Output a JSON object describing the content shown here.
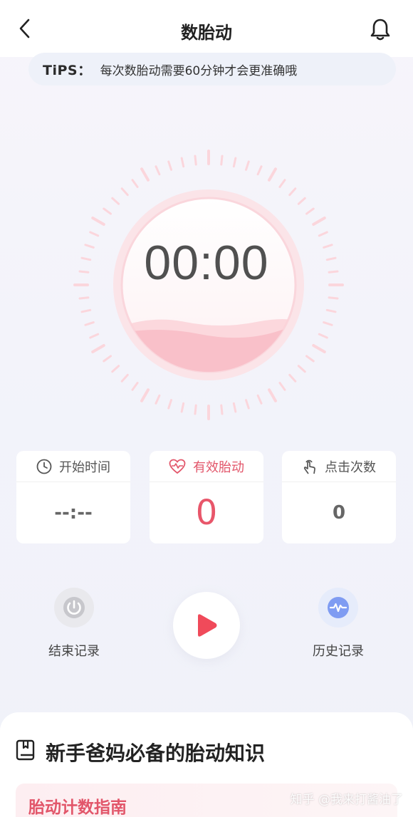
{
  "header": {
    "title": "数胎动"
  },
  "tips": {
    "label": "TiPS：",
    "text": "每次数胎动需要60分钟才会更准确哦"
  },
  "timer": {
    "display": "00:00"
  },
  "stats": [
    {
      "label": "开始时间",
      "value": "--:--"
    },
    {
      "label": "有效胎动",
      "value": "0"
    },
    {
      "label": "点击次数",
      "value": "0"
    }
  ],
  "controls": {
    "end_label": "结束记录",
    "history_label": "历史记录"
  },
  "knowledge": {
    "title": "新手爸妈必备的胎动知识",
    "guide_title": "胎动计数指南"
  },
  "watermark": "知乎 @我来打酱油了",
  "colors": {
    "accent": "#e8566a",
    "play": "#f04a5a",
    "history": "#6b8ff0"
  }
}
